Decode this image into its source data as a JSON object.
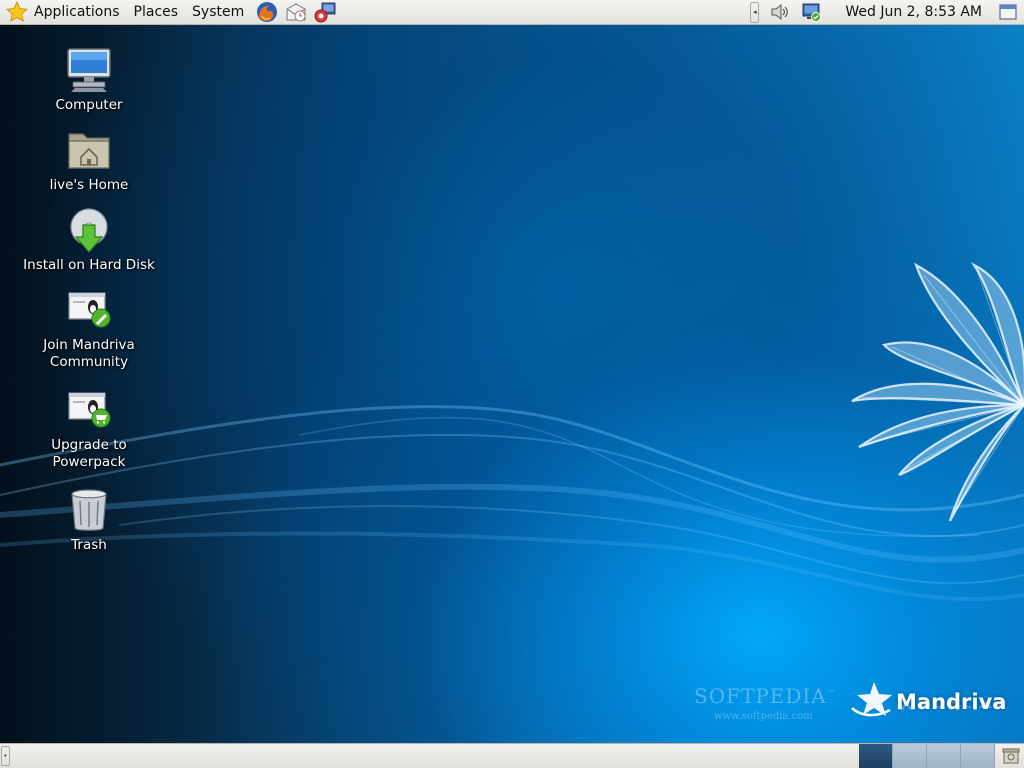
{
  "top_panel": {
    "menus": {
      "applications": "Applications",
      "places": "Places",
      "system": "System"
    },
    "launchers": [
      {
        "name": "firefox-icon"
      },
      {
        "name": "email-client-icon"
      },
      {
        "name": "remote-desktop-icon"
      }
    ],
    "tray": {
      "volume_icon": "speaker-icon",
      "network_icon": "network-status-icon"
    },
    "clock": "Wed Jun  2,  8:53 AM"
  },
  "desktop": {
    "icons": [
      {
        "label": "Computer",
        "icon": "computer-icon"
      },
      {
        "label": "live's Home",
        "icon": "home-folder-icon"
      },
      {
        "label": "Install on Hard Disk",
        "icon": "install-disk-icon"
      },
      {
        "label": "Join Mandriva Community",
        "icon": "join-community-icon"
      },
      {
        "label": "Upgrade to Powerpack",
        "icon": "upgrade-powerpack-icon"
      },
      {
        "label": "Trash",
        "icon": "trash-icon"
      }
    ],
    "branding": {
      "softpedia": "SOFTPEDIA",
      "softpedia_tm": "™",
      "softpedia_url": "www.softpedia.com",
      "mandriva": "Mandriva"
    }
  },
  "bottom_panel": {
    "workspaces": [
      "1",
      "2",
      "3",
      "4"
    ],
    "active_workspace": 1
  },
  "colors": {
    "panel_bg": "#e3e2dd",
    "desktop_blue": "#0a7fc6",
    "desktop_dark": "#03101c",
    "workspace_active": "#1d3f60"
  }
}
